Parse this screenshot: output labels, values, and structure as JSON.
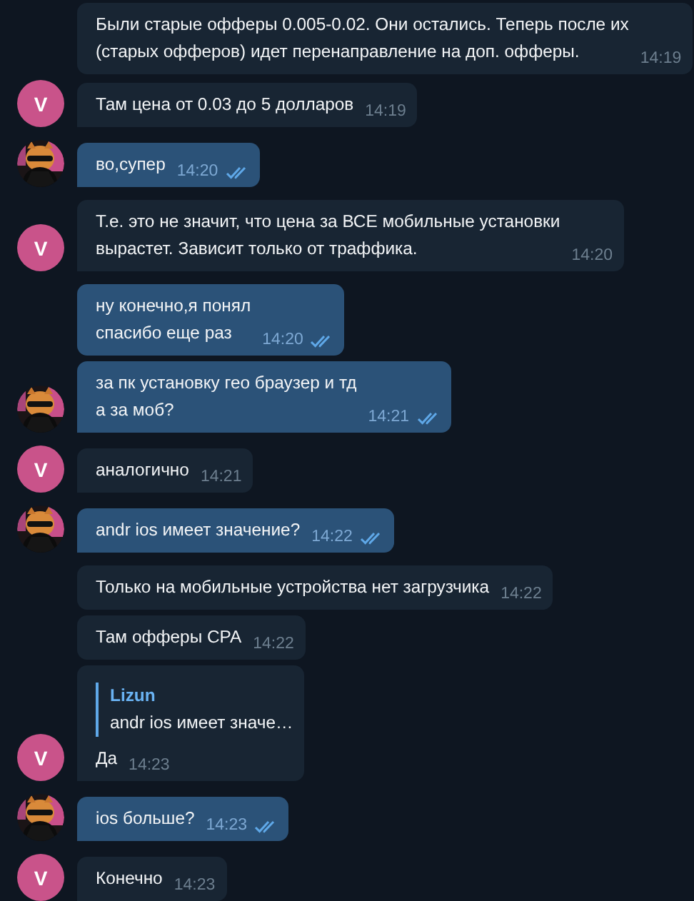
{
  "messages": [
    {
      "kind": "incoming",
      "text": "Были старые офферы 0.005-0.02. Они остались. Теперь после их\n(старых офферов) идет перенаправление на доп. офферы.",
      "time": "14:19"
    },
    {
      "kind": "incoming",
      "text": "Там цена от 0.03 до 5 долларов",
      "time": "14:19",
      "avatar": {
        "kind": "letter",
        "letter": "V"
      }
    },
    {
      "kind": "outgoing",
      "text": "во,супер",
      "time": "14:20",
      "read": true
    },
    {
      "kind": "incoming",
      "text": "Т.е. это не значит, что цена за ВСЕ мобильные установки\nвырастет. Зависит только от траффика.",
      "time": "14:20",
      "avatar": {
        "kind": "letter",
        "letter": "V"
      }
    },
    {
      "kind": "outgoing",
      "text": "ну конечно,я понял\nспасибо еще раз",
      "time": "14:20",
      "read": true
    },
    {
      "kind": "outgoing",
      "text": "за пк установку гео браузер и тд\nа за моб?",
      "time": "14:21",
      "read": true
    },
    {
      "kind": "incoming",
      "text": "аналогично",
      "time": "14:21",
      "avatar": {
        "kind": "letter",
        "letter": "V"
      }
    },
    {
      "kind": "outgoing",
      "text": "andr ios имеет значение?",
      "time": "14:22",
      "read": true
    },
    {
      "kind": "incoming",
      "text": "Только на мобильные устройства нет загрузчика",
      "time": "14:22"
    },
    {
      "kind": "incoming",
      "text": "Там офферы CPA",
      "time": "14:22"
    },
    {
      "kind": "incoming",
      "text": "Да",
      "time": "14:23",
      "reply": {
        "author": "Lizun",
        "text": "andr ios имеет значе…"
      },
      "avatar": {
        "kind": "letter",
        "letter": "V"
      }
    },
    {
      "kind": "outgoing",
      "text": "ios больше?",
      "time": "14:23",
      "read": true
    },
    {
      "kind": "incoming",
      "text": "Конечно",
      "time": "14:23",
      "avatar": {
        "kind": "letter",
        "letter": "V"
      }
    }
  ]
}
